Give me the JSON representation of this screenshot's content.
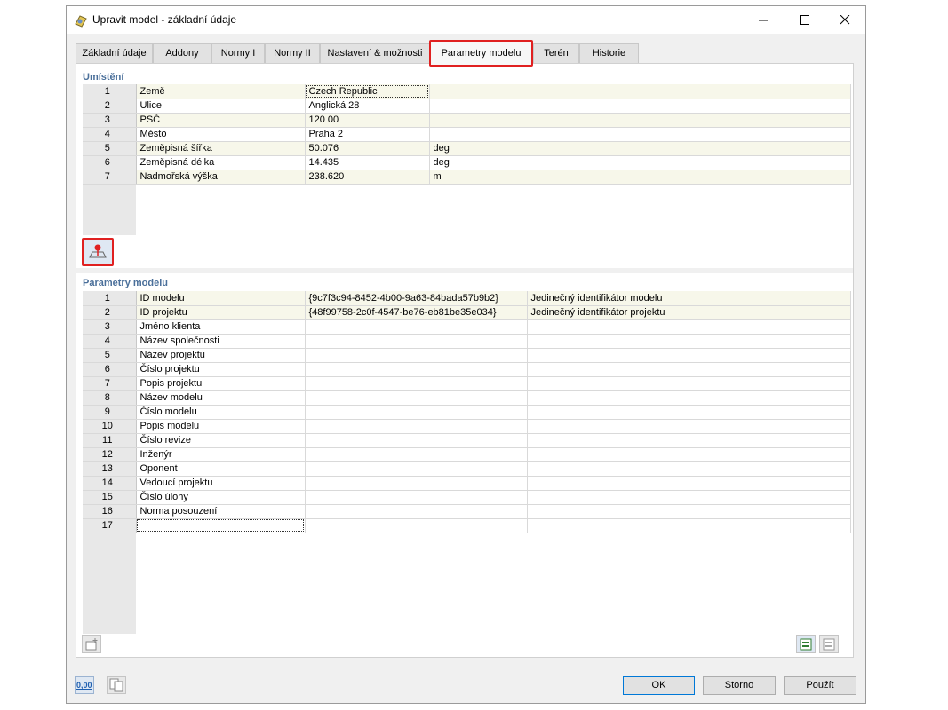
{
  "window": {
    "title": "Upravit model - základní údaje"
  },
  "tabs": [
    {
      "label": "Základní údaje"
    },
    {
      "label": "Addony"
    },
    {
      "label": "Normy I"
    },
    {
      "label": "Normy II"
    },
    {
      "label": "Nastavení & možnosti"
    },
    {
      "label": "Parametry modelu"
    },
    {
      "label": "Terén"
    },
    {
      "label": "Historie"
    }
  ],
  "location": {
    "title": "Umístění",
    "rows": [
      {
        "num": "1",
        "name": "Země",
        "value": "Czech Republic",
        "unit": ""
      },
      {
        "num": "2",
        "name": "Ulice",
        "value": "Anglická 28",
        "unit": ""
      },
      {
        "num": "3",
        "name": "PSČ",
        "value": "120 00",
        "unit": ""
      },
      {
        "num": "4",
        "name": "Město",
        "value": "Praha 2",
        "unit": ""
      },
      {
        "num": "5",
        "name": "Zeměpisná šířka",
        "value": "50.076",
        "unit": "deg"
      },
      {
        "num": "6",
        "name": "Zeměpisná délka",
        "value": "14.435",
        "unit": "deg"
      },
      {
        "num": "7",
        "name": "Nadmořská výška",
        "value": "238.620",
        "unit": "m"
      }
    ]
  },
  "model_params": {
    "title": "Parametry modelu",
    "rows": [
      {
        "num": "1",
        "name": "ID modelu",
        "value": "{9c7f3c94-8452-4b00-9a63-84bada57b9b2}",
        "desc": "Jedinečný identifikátor modelu"
      },
      {
        "num": "2",
        "name": "ID projektu",
        "value": "{48f99758-2c0f-4547-be76-eb81be35e034}",
        "desc": "Jedinečný identifikátor projektu"
      },
      {
        "num": "3",
        "name": "Jméno klienta",
        "value": "",
        "desc": ""
      },
      {
        "num": "4",
        "name": "Název společnosti",
        "value": "",
        "desc": ""
      },
      {
        "num": "5",
        "name": "Název projektu",
        "value": "",
        "desc": ""
      },
      {
        "num": "6",
        "name": "Číslo projektu",
        "value": "",
        "desc": ""
      },
      {
        "num": "7",
        "name": "Popis projektu",
        "value": "",
        "desc": ""
      },
      {
        "num": "8",
        "name": "Název modelu",
        "value": "",
        "desc": ""
      },
      {
        "num": "9",
        "name": "Číslo modelu",
        "value": "",
        "desc": ""
      },
      {
        "num": "10",
        "name": "Popis modelu",
        "value": "",
        "desc": ""
      },
      {
        "num": "11",
        "name": "Číslo revize",
        "value": "",
        "desc": ""
      },
      {
        "num": "12",
        "name": "Inženýr",
        "value": "",
        "desc": ""
      },
      {
        "num": "13",
        "name": "Oponent",
        "value": "",
        "desc": ""
      },
      {
        "num": "14",
        "name": "Vedoucí projektu",
        "value": "",
        "desc": ""
      },
      {
        "num": "15",
        "name": "Číslo úlohy",
        "value": "",
        "desc": ""
      },
      {
        "num": "16",
        "name": "Norma posouzení",
        "value": "",
        "desc": ""
      },
      {
        "num": "17",
        "name": "",
        "value": "",
        "desc": ""
      }
    ]
  },
  "footer": {
    "units_badge": "0,00",
    "ok_label": "OK",
    "cancel_label": "Storno",
    "apply_label": "Použít"
  },
  "colors": {
    "accent": "#0078d7",
    "highlight": "#e02020",
    "section_title": "#4a6f9a",
    "alt_row": "#f7f7ea"
  }
}
